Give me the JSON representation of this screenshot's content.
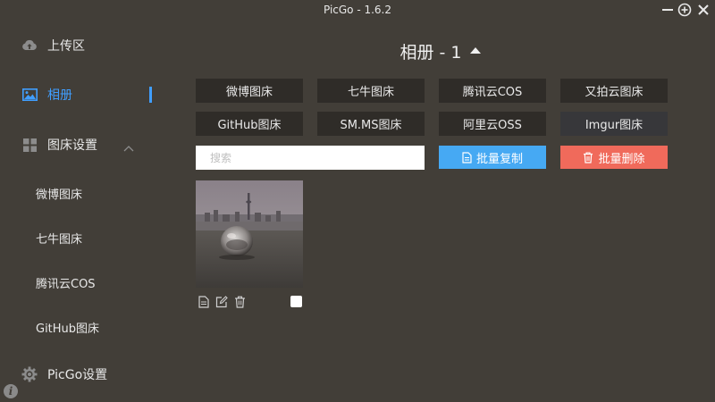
{
  "window": {
    "title": "PicGo - 1.6.2"
  },
  "sidebar": {
    "upload": "上传区",
    "album": "相册",
    "pic_bed_settings": "图床设置",
    "sub_items": [
      "微博图床",
      "七牛图床",
      "腾讯云COS",
      "GitHub图床"
    ],
    "picgo_settings": "PicGo设置"
  },
  "main": {
    "title": "相册 - 1",
    "pic_beds": [
      "微博图床",
      "七牛图床",
      "腾讯云COS",
      "又拍云图床",
      "GitHub图床",
      "SM.MS图床",
      "阿里云OSS",
      "Imgur图床"
    ],
    "search_placeholder": "搜索",
    "batch_copy": "批量复制",
    "batch_delete": "批量删除"
  },
  "colors": {
    "background": "#423e38",
    "accent": "#409eff",
    "copy": "#46a9f3",
    "delete": "#f06a5b",
    "button": "#2f2c28"
  },
  "icons": [
    "minimize-icon",
    "maximize-icon",
    "close-icon",
    "cloud-upload-icon",
    "picture-icon",
    "grid-icon",
    "chevron-up-icon",
    "gear-icon",
    "info-icon",
    "file-icon",
    "edit-icon",
    "trash-icon"
  ]
}
